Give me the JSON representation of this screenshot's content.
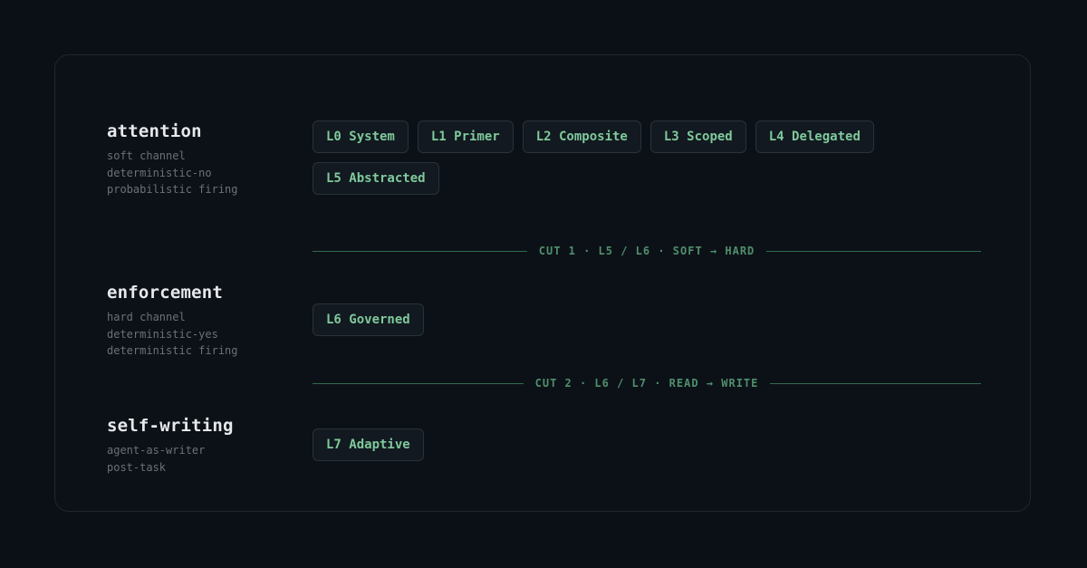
{
  "tiers": [
    {
      "title": "attention",
      "desc": [
        "soft channel",
        "deterministic-no",
        "probabilistic firing"
      ],
      "levels": [
        "L0 System",
        "L1 Primer",
        "L2 Composite",
        "L3 Scoped",
        "L4 Delegated",
        "L5 Abstracted"
      ]
    },
    {
      "title": "enforcement",
      "desc": [
        "hard channel",
        "deterministic-yes",
        "deterministic firing"
      ],
      "levels": [
        "L6 Governed"
      ]
    },
    {
      "title": "self-writing",
      "desc": [
        "agent-as-writer",
        "post-task"
      ],
      "levels": [
        "L7 Adaptive"
      ]
    }
  ],
  "cuts": [
    "CUT 1 · L5 / L6 · SOFT → HARD",
    "CUT 2 · L6 / L7 · READ → WRITE"
  ],
  "colors": {
    "background": "#0b1016",
    "card": "#0c1117",
    "accent": "#7fc99b",
    "cut_line": "#2f6b4c"
  }
}
